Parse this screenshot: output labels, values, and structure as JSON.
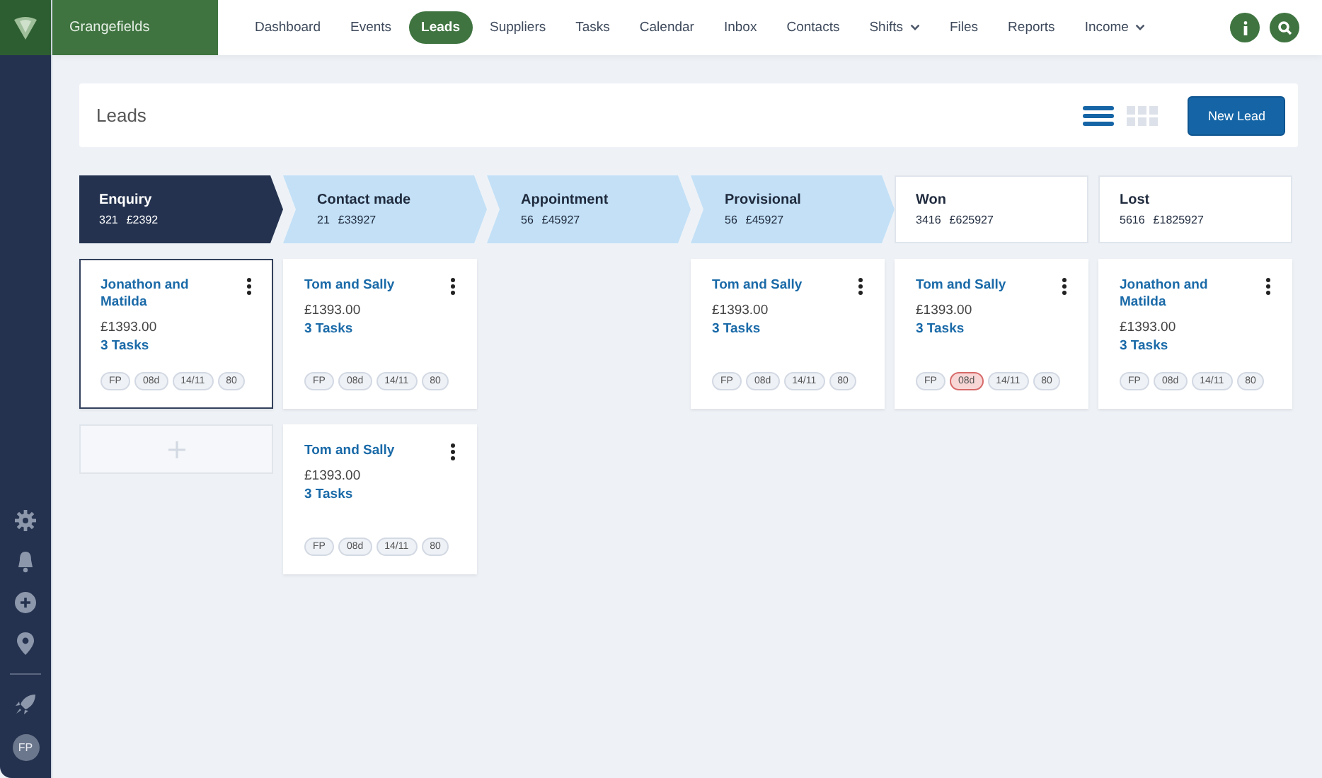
{
  "brand": {
    "name": "Grangefields"
  },
  "nav": [
    {
      "label": "Dashboard",
      "selected": false
    },
    {
      "label": "Events",
      "selected": false
    },
    {
      "label": "Leads",
      "selected": true
    },
    {
      "label": "Suppliers",
      "selected": false
    },
    {
      "label": "Tasks",
      "selected": false
    },
    {
      "label": "Calendar",
      "selected": false
    },
    {
      "label": "Inbox",
      "selected": false
    },
    {
      "label": "Contacts",
      "selected": false
    },
    {
      "label": "Shifts",
      "selected": false,
      "dropdown": true
    },
    {
      "label": "Files",
      "selected": false
    },
    {
      "label": "Reports",
      "selected": false
    },
    {
      "label": "Income",
      "selected": false,
      "dropdown": true
    }
  ],
  "sidebar": {
    "avatar": "FP"
  },
  "header": {
    "title": "Leads",
    "button": "New Lead"
  },
  "view_toggles": [
    {
      "kind": "list",
      "selected": true
    },
    {
      "kind": "grid",
      "selected": false
    }
  ],
  "stages": [
    {
      "name": "Enquiry",
      "count": "321",
      "amount": "£2392",
      "kind": "arrow",
      "selected": true,
      "add_button": true,
      "cards": [
        {
          "name": "Jonathon and Matilda",
          "price": "£1393.00",
          "tasks": "3 Tasks",
          "selected": true,
          "tags": [
            {
              "text": "FP",
              "alert": false
            },
            {
              "text": "08d",
              "alert": false
            },
            {
              "text": "14/11",
              "alert": false
            },
            {
              "text": "80",
              "alert": false
            }
          ]
        }
      ]
    },
    {
      "name": "Contact made",
      "count": "21",
      "amount": "£33927",
      "kind": "arrow",
      "selected": false,
      "cards": [
        {
          "name": "Tom and Sally",
          "price": "£1393.00",
          "tasks": "3 Tasks",
          "selected": false,
          "tags": [
            {
              "text": "FP",
              "alert": false
            },
            {
              "text": "08d",
              "alert": false
            },
            {
              "text": "14/11",
              "alert": false
            },
            {
              "text": "80",
              "alert": false
            }
          ]
        },
        {
          "name": "Tom and Sally",
          "price": "£1393.00",
          "tasks": "3 Tasks",
          "selected": false,
          "tags": [
            {
              "text": "FP",
              "alert": false
            },
            {
              "text": "08d",
              "alert": false
            },
            {
              "text": "14/11",
              "alert": false
            },
            {
              "text": "80",
              "alert": false
            }
          ]
        }
      ]
    },
    {
      "name": "Appointment",
      "count": "56",
      "amount": "£45927",
      "kind": "arrow",
      "selected": false
    },
    {
      "name": "Provisional",
      "count": "56",
      "amount": "£45927",
      "kind": "arrow",
      "selected": false,
      "cards": [
        {
          "name": "Tom and Sally",
          "price": "£1393.00",
          "tasks": "3 Tasks",
          "selected": false,
          "tags": [
            {
              "text": "FP",
              "alert": false
            },
            {
              "text": "08d",
              "alert": false
            },
            {
              "text": "14/11",
              "alert": false
            },
            {
              "text": "80",
              "alert": false
            }
          ]
        }
      ]
    },
    {
      "name": "Won",
      "count": "3416",
      "amount": "£625927",
      "kind": "box",
      "selected": false,
      "cards": [
        {
          "name": "Tom and Sally",
          "price": "£1393.00",
          "tasks": "3 Tasks",
          "selected": false,
          "tags": [
            {
              "text": "FP",
              "alert": false
            },
            {
              "text": "08d",
              "alert": true
            },
            {
              "text": "14/11",
              "alert": false
            },
            {
              "text": "80",
              "alert": false
            }
          ]
        }
      ]
    },
    {
      "name": "Lost",
      "count": "5616",
      "amount": "£1825927",
      "kind": "box",
      "selected": false,
      "cards": [
        {
          "name": "Jonathon and Matilda",
          "price": "£1393.00",
          "tasks": "3 Tasks",
          "selected": false,
          "tags": [
            {
              "text": "FP",
              "alert": false
            },
            {
              "text": "08d",
              "alert": false
            },
            {
              "text": "14/11",
              "alert": false
            },
            {
              "text": "80",
              "alert": false
            }
          ]
        }
      ]
    }
  ]
}
